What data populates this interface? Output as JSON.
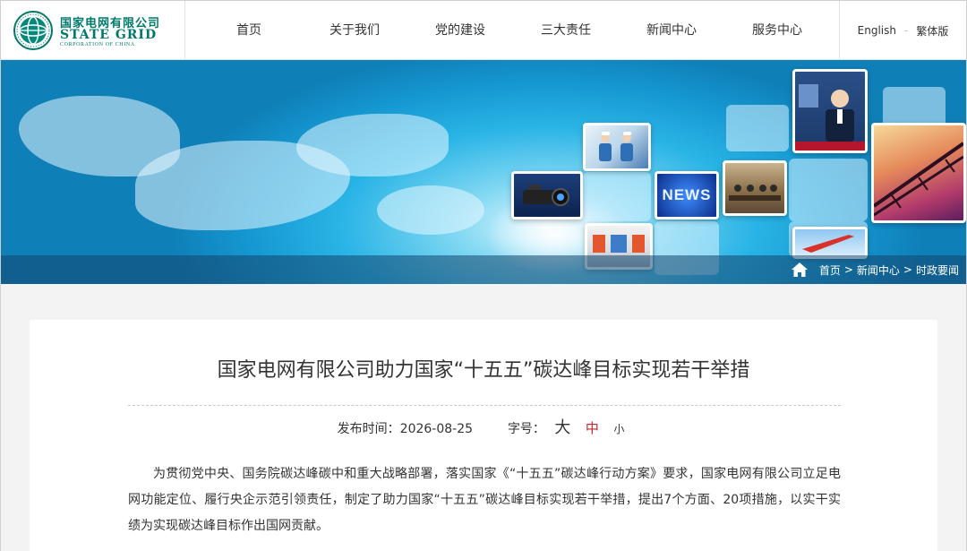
{
  "header": {
    "logo": {
      "cn": "国家电网有限公司",
      "en": "STATE GRID",
      "sub": "CORPORATION OF CHINA"
    },
    "nav": [
      "首页",
      "关于我们",
      "党的建设",
      "三大责任",
      "新闻中心",
      "服务中心"
    ],
    "lang": {
      "english": "English",
      "separator": "-",
      "traditional": "繁体版"
    }
  },
  "banner": {
    "breadcrumb": [
      "首页",
      "新闻中心",
      "时政要闻"
    ],
    "breadcrumb_sep": ">",
    "icons": [
      "home-icon"
    ],
    "news_tile_text": "NEWS"
  },
  "article": {
    "title": "国家电网有限公司助力国家“十五五”碳达峰目标实现若干举措",
    "publish_label": "发布时间：",
    "publish_date": "2026-08-25",
    "font_size_label": "字号：",
    "font_sizes": [
      "大",
      "中",
      "小"
    ],
    "body": "为贯彻党中央、国务院碳达峰碳中和重大战略部署，落实国家《“十五五”碳达峰行动方案》要求，国家电网有限公司立足电网功能定位、履行央企示范引领责任，制定了助力国家“十五五”碳达峰目标实现若干举措，提出7个方面、20项措施，以实干实绩为实现碳达峰目标作出国网贡献。"
  },
  "colors": {
    "brand_green": "#00796b",
    "active_size": "#c1272d",
    "banner_blue": "#1597d0"
  }
}
